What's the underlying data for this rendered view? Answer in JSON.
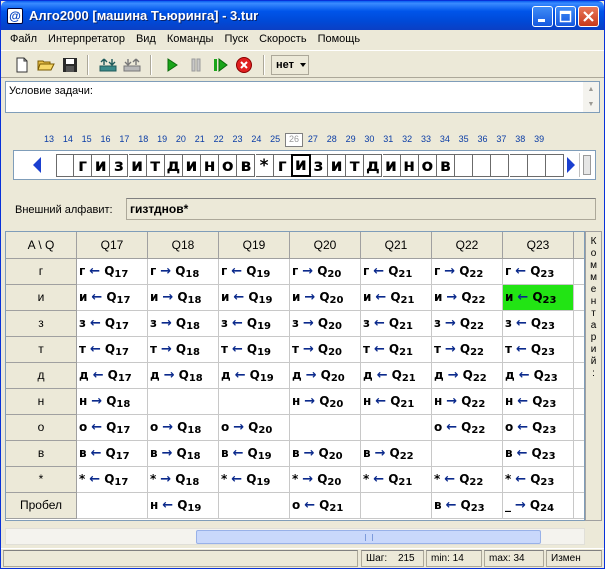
{
  "window": {
    "title": "Алго2000 [машина Тьюринга] - 3.tur"
  },
  "menu": [
    "Файл",
    "Интерпретатор",
    "Вид",
    "Команды",
    "Пуск",
    "Скорость",
    "Помощь"
  ],
  "toolbar": {
    "speed_value": "нет"
  },
  "condition": {
    "label": "Условие задачи:"
  },
  "tape": {
    "numbers": [
      "13",
      "14",
      "15",
      "16",
      "17",
      "18",
      "19",
      "20",
      "21",
      "22",
      "23",
      "24",
      "25",
      "26",
      "27",
      "28",
      "29",
      "30",
      "31",
      "32",
      "33",
      "34",
      "35",
      "36",
      "37",
      "38",
      "39"
    ],
    "current_number": "26",
    "cells": [
      "",
      "г",
      "и",
      "з",
      "и",
      "т",
      "д",
      "и",
      "н",
      "о",
      "в",
      "*",
      "г",
      "и",
      "з",
      "и",
      "т",
      "д",
      "и",
      "н",
      "о",
      "в",
      "",
      "",
      "",
      "",
      "",
      ""
    ],
    "head_index": 13
  },
  "alphabet": {
    "label": "Внешний алфавит:",
    "value": "гизтднов*"
  },
  "table": {
    "corner": "A \\ Q",
    "states": [
      "Q17",
      "Q18",
      "Q19",
      "Q20",
      "Q21",
      "Q22",
      "Q23"
    ],
    "rows": [
      {
        "symbol": "г",
        "cells": [
          [
            "г",
            "←",
            "Q",
            "17"
          ],
          [
            "г",
            "→",
            "Q",
            "18"
          ],
          [
            "г",
            "←",
            "Q",
            "19"
          ],
          [
            "г",
            "→",
            "Q",
            "20"
          ],
          [
            "г",
            "←",
            "Q",
            "21"
          ],
          [
            "г",
            "→",
            "Q",
            "22"
          ],
          [
            "г",
            "←",
            "Q",
            "23"
          ]
        ]
      },
      {
        "symbol": "и",
        "cells": [
          [
            "и",
            "←",
            "Q",
            "17"
          ],
          [
            "и",
            "→",
            "Q",
            "18"
          ],
          [
            "и",
            "←",
            "Q",
            "19"
          ],
          [
            "и",
            "→",
            "Q",
            "20"
          ],
          [
            "и",
            "←",
            "Q",
            "21"
          ],
          [
            "и",
            "→",
            "Q",
            "22"
          ],
          [
            "и",
            "←",
            "Q",
            "23"
          ]
        ]
      },
      {
        "symbol": "з",
        "cells": [
          [
            "з",
            "←",
            "Q",
            "17"
          ],
          [
            "з",
            "→",
            "Q",
            "18"
          ],
          [
            "з",
            "←",
            "Q",
            "19"
          ],
          [
            "з",
            "→",
            "Q",
            "20"
          ],
          [
            "з",
            "←",
            "Q",
            "21"
          ],
          [
            "з",
            "→",
            "Q",
            "22"
          ],
          [
            "з",
            "←",
            "Q",
            "23"
          ]
        ]
      },
      {
        "symbol": "т",
        "cells": [
          [
            "т",
            "←",
            "Q",
            "17"
          ],
          [
            "т",
            "→",
            "Q",
            "18"
          ],
          [
            "т",
            "←",
            "Q",
            "19"
          ],
          [
            "т",
            "→",
            "Q",
            "20"
          ],
          [
            "т",
            "←",
            "Q",
            "21"
          ],
          [
            "т",
            "→",
            "Q",
            "22"
          ],
          [
            "т",
            "←",
            "Q",
            "23"
          ]
        ]
      },
      {
        "symbol": "д",
        "cells": [
          [
            "д",
            "←",
            "Q",
            "17"
          ],
          [
            "д",
            "→",
            "Q",
            "18"
          ],
          [
            "д",
            "←",
            "Q",
            "19"
          ],
          [
            "д",
            "→",
            "Q",
            "20"
          ],
          [
            "д",
            "←",
            "Q",
            "21"
          ],
          [
            "д",
            "→",
            "Q",
            "22"
          ],
          [
            "д",
            "←",
            "Q",
            "23"
          ]
        ]
      },
      {
        "symbol": "н",
        "cells": [
          [
            "н",
            "→",
            "Q",
            "18"
          ],
          null,
          null,
          [
            "н",
            "→",
            "Q",
            "20"
          ],
          [
            "н",
            "←",
            "Q",
            "21"
          ],
          [
            "н",
            "→",
            "Q",
            "22"
          ],
          [
            "н",
            "←",
            "Q",
            "23"
          ]
        ]
      },
      {
        "symbol": "о",
        "cells": [
          [
            "о",
            "←",
            "Q",
            "17"
          ],
          [
            "о",
            "→",
            "Q",
            "18"
          ],
          [
            "о",
            "→",
            "Q",
            "20"
          ],
          null,
          null,
          [
            "о",
            "←",
            "Q",
            "22"
          ],
          [
            "о",
            "←",
            "Q",
            "23"
          ]
        ]
      },
      {
        "symbol": "в",
        "cells": [
          [
            "в",
            "←",
            "Q",
            "17"
          ],
          [
            "в",
            "→",
            "Q",
            "18"
          ],
          [
            "в",
            "←",
            "Q",
            "19"
          ],
          [
            "в",
            "→",
            "Q",
            "20"
          ],
          [
            "в",
            "→",
            "Q",
            "22"
          ],
          null,
          [
            "в",
            "←",
            "Q",
            "23"
          ]
        ]
      },
      {
        "symbol": "*",
        "cells": [
          [
            "*",
            "←",
            "Q",
            "17"
          ],
          [
            "*",
            "→",
            "Q",
            "18"
          ],
          [
            "*",
            "←",
            "Q",
            "19"
          ],
          [
            "*",
            "→",
            "Q",
            "20"
          ],
          [
            "*",
            "←",
            "Q",
            "21"
          ],
          [
            "*",
            "←",
            "Q",
            "22"
          ],
          [
            "*",
            "←",
            "Q",
            "23"
          ]
        ]
      },
      {
        "symbol": "Пробел",
        "cells": [
          null,
          [
            "н",
            "←",
            "Q",
            "19"
          ],
          null,
          [
            "о",
            "←",
            "Q",
            "21"
          ],
          null,
          [
            "в",
            "←",
            "Q",
            "23"
          ],
          [
            "_",
            "→",
            "Q",
            "24"
          ]
        ]
      }
    ],
    "highlight": {
      "row": 1,
      "col": 6,
      "color": "#22e414"
    }
  },
  "comment": {
    "label": "Комментарий:"
  },
  "status": {
    "step_label": "Шаг:",
    "step_value": "215",
    "min": "min: 14",
    "max": "max: 34",
    "changed": "Измен"
  },
  "colors": {
    "arrow": "#0b2a8c",
    "titlebar": "#0055ea",
    "tape_number": "#0b3da6"
  }
}
